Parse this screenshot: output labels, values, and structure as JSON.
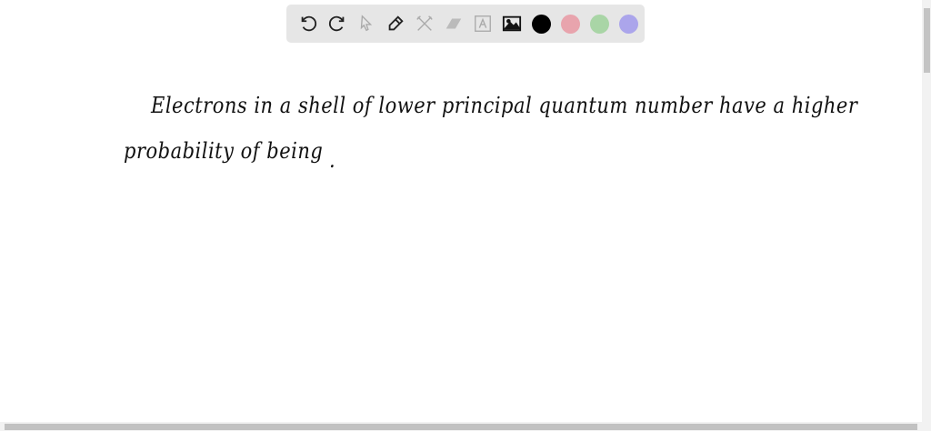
{
  "toolbar": {
    "tools": [
      "undo-icon",
      "redo-icon",
      "select-icon",
      "pen-icon",
      "tools-icon",
      "eraser-icon",
      "text-icon",
      "image-icon"
    ],
    "colors": [
      "#000000",
      "#e8a4ad",
      "#a9d5a6",
      "#aba5eb"
    ]
  },
  "canvas": {
    "line1": "Electrons in a shell of lower principal quantum number have a higher",
    "line2": "probability of being",
    "line2_end": "."
  }
}
